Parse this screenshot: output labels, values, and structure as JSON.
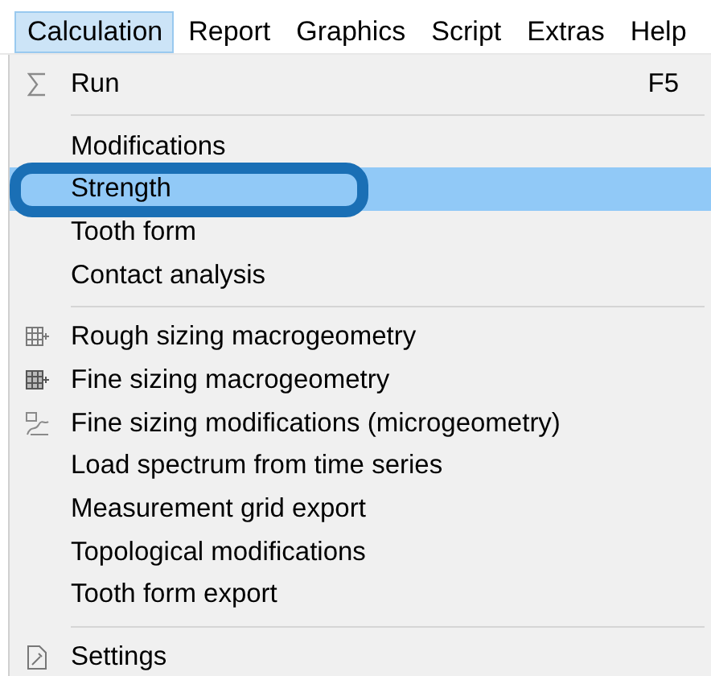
{
  "menu_bar": [
    {
      "label": "Calculation",
      "selected": true
    },
    {
      "label": "Report",
      "selected": false
    },
    {
      "label": "Graphics",
      "selected": false
    },
    {
      "label": "Script",
      "selected": false
    },
    {
      "label": "Extras",
      "selected": false
    },
    {
      "label": "Help",
      "selected": false
    }
  ],
  "menu": [
    {
      "kind": "sum",
      "label": "Run",
      "shortcut": "F5",
      "selected": false
    },
    {
      "kind": "separator"
    },
    {
      "kind": "item",
      "label": "Modifications",
      "selected": false
    },
    {
      "kind": "item",
      "label": "Strength",
      "selected": true
    },
    {
      "kind": "item",
      "label": "Tooth form",
      "selected": false
    },
    {
      "kind": "item",
      "label": "Contact analysis",
      "selected": false
    },
    {
      "kind": "separator"
    },
    {
      "kind": "grid",
      "label": "Rough sizing macrogeometry",
      "selected": false
    },
    {
      "kind": "filledgrid",
      "label": "Fine sizing macrogeometry",
      "selected": false
    },
    {
      "kind": "curve",
      "label": "Fine sizing modifications (microgeometry)",
      "selected": false
    },
    {
      "kind": "item",
      "label": "Load spectrum from time series",
      "selected": false
    },
    {
      "kind": "item",
      "label": "Measurement grid export",
      "selected": false
    },
    {
      "kind": "item",
      "label": "Topological modifications",
      "selected": false
    },
    {
      "kind": "item",
      "label": "Tooth form export",
      "selected": false
    },
    {
      "kind": "separator"
    },
    {
      "kind": "document",
      "label": "Settings",
      "selected": false
    }
  ],
  "annotation": {
    "kind": "rounded-box"
  }
}
